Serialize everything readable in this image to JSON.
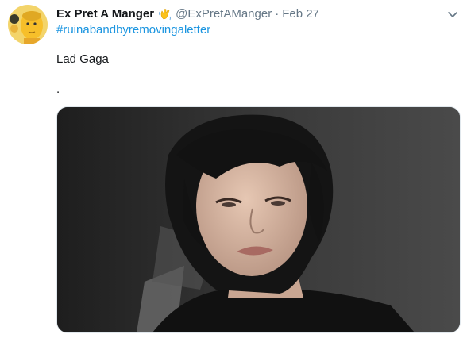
{
  "tweet": {
    "display_name": "Ex Pret A Manger",
    "handle": "@ExPretAManger",
    "separator": "·",
    "date": "Feb 27",
    "hashtag": "#ruinabandbyremovingaletter",
    "text": "Lad Gaga",
    "dot_line": ".",
    "emoji_icon": "waving-hand-emoji",
    "avatar_icon": "avatar-image",
    "media_icon": "tweet-photo"
  },
  "colors": {
    "hashtag": "#1b95e0",
    "secondary_text": "#657786",
    "primary_text": "#14171a"
  }
}
